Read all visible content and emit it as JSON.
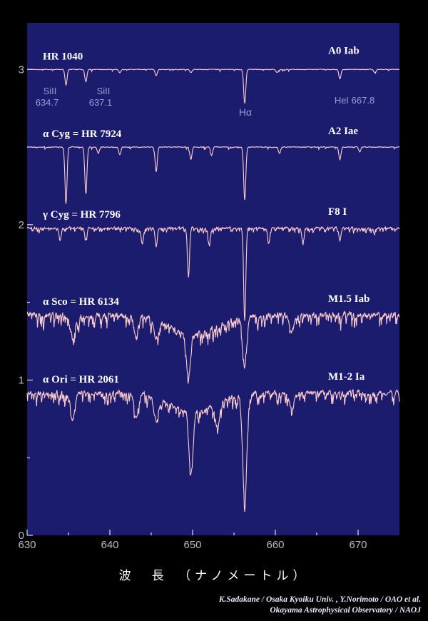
{
  "colors": {
    "background": "#000000",
    "plot_bg": "#1c1c6e",
    "spectrum": "#ffcccc",
    "text": "#ffffff",
    "line_id": "#9a9ad8"
  },
  "chart_data": {
    "type": "line",
    "title": "",
    "xlabel": "波　長　（ナノメートル）",
    "ylabel": "",
    "xlim": [
      630,
      675
    ],
    "ylim": [
      0,
      3.3
    ],
    "grid": false,
    "x_ticks": [
      "630",
      "640",
      "650",
      "660",
      "670"
    ],
    "y_ticks": [
      "0",
      "1",
      "2",
      "3"
    ],
    "series": [
      {
        "name": "HR 1040",
        "star": "HR 1040",
        "spectral_type": "A0 Iab",
        "baseline": 3.0,
        "noise": 0.006,
        "lines": [
          [
            634.7,
            0.1
          ],
          [
            637.1,
            0.08
          ],
          [
            645.6,
            0.04
          ],
          [
            649.8,
            0.02
          ],
          [
            656.3,
            0.22
          ],
          [
            667.8,
            0.06
          ],
          [
            641.2,
            0.02
          ],
          [
            660.2,
            0.02
          ],
          [
            672.0,
            0.02
          ]
        ]
      },
      {
        "name": "α Cyg = HR 7924",
        "star": "α Cyg = HR 7924",
        "spectral_type": "A2 Iae",
        "baseline": 2.5,
        "noise": 0.008,
        "lines": [
          [
            634.7,
            0.36
          ],
          [
            637.1,
            0.3
          ],
          [
            645.6,
            0.16
          ],
          [
            649.8,
            0.08
          ],
          [
            656.3,
            0.34
          ],
          [
            667.8,
            0.08
          ],
          [
            641.2,
            0.05
          ],
          [
            638.6,
            0.04
          ],
          [
            652.3,
            0.05
          ],
          [
            660.5,
            0.04
          ],
          [
            670.2,
            0.03
          ]
        ]
      },
      {
        "name": "γ Cyg = HR 7796",
        "star": "γ Cyg = HR 7796",
        "spectral_type": "F8 I",
        "baseline": 1.98,
        "noise": 0.02,
        "lines": [
          [
            643.9,
            0.1
          ],
          [
            645.6,
            0.12
          ],
          [
            649.5,
            0.3
          ],
          [
            652.0,
            0.1
          ],
          [
            656.3,
            0.6
          ],
          [
            659.2,
            0.1
          ],
          [
            663.3,
            0.08
          ],
          [
            667.8,
            0.08
          ],
          [
            634.0,
            0.08
          ],
          [
            637.1,
            0.08
          ]
        ]
      },
      {
        "name": "α Sco = HR 6134",
        "star": "α Sco = HR 6134",
        "spectral_type": "M1.5 Iab",
        "baseline": 1.42,
        "noise": 0.06,
        "lines": [
          [
            649.5,
            0.28
          ],
          [
            656.3,
            0.3
          ],
          [
            645.6,
            0.12
          ],
          [
            643.2,
            0.12
          ],
          [
            635.5,
            0.15
          ],
          [
            662.0,
            0.1
          ]
        ]
      },
      {
        "name": "α Ori = HR 2061",
        "star": "α Ori = HR 2061",
        "spectral_type": "M1-2 Ia",
        "baseline": 0.92,
        "noise": 0.05,
        "lines": [
          [
            649.8,
            0.4
          ],
          [
            656.3,
            0.7
          ],
          [
            645.6,
            0.15
          ],
          [
            643.2,
            0.15
          ],
          [
            635.5,
            0.18
          ],
          [
            653.0,
            0.15
          ],
          [
            662.0,
            0.1
          ]
        ]
      }
    ],
    "annotations": [
      {
        "label": "SiII",
        "sub": "634.7"
      },
      {
        "label": "SiII",
        "sub": "637.1"
      },
      {
        "label": "Hα",
        "sub": ""
      },
      {
        "label": "HeI 667.8",
        "sub": ""
      }
    ]
  },
  "credits": {
    "line1": "K.Sadakane / Osaka Kyoiku Univ. , Y.Norimoto / OAO et al.",
    "line2": "Okayama Astrophysical Observatory / NAOJ"
  }
}
